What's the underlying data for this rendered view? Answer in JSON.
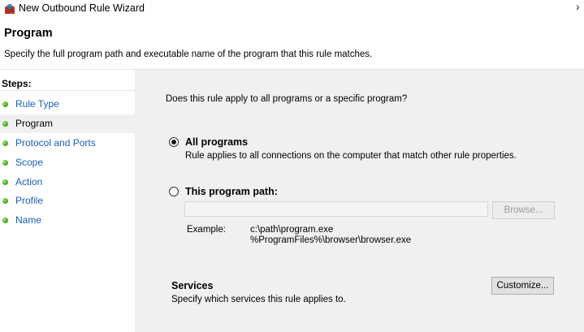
{
  "window": {
    "title": "New Outbound Rule Wizard",
    "close_glyph": "›"
  },
  "header": {
    "title": "Program",
    "description": "Specify the full program path and executable name of the program that this rule matches."
  },
  "sidebar": {
    "heading": "Steps:",
    "items": [
      {
        "label": "Rule Type"
      },
      {
        "label": "Program"
      },
      {
        "label": "Protocol and Ports"
      },
      {
        "label": "Scope"
      },
      {
        "label": "Action"
      },
      {
        "label": "Profile"
      },
      {
        "label": "Name"
      }
    ],
    "active_item": "Program"
  },
  "main": {
    "question": "Does this rule apply to all programs or a specific program?",
    "options": [
      {
        "label": "All programs",
        "description": "Rule applies to all connections on the computer that match other rule properties.",
        "selected": true
      },
      {
        "label": "This program path:",
        "selected": false
      }
    ],
    "path_input": {
      "value": ""
    },
    "browse_label": "Browse...",
    "example_label": "Example:",
    "example_lines": [
      "c:\\path\\program.exe",
      "%ProgramFiles%\\browser\\browser.exe"
    ],
    "services_title": "Services",
    "services_desc": "Specify which services this rule applies to.",
    "customize_label": "Customize..."
  },
  "icons": {
    "app": "firewall-shield-icon",
    "step_bullet": "green-dot-icon"
  }
}
